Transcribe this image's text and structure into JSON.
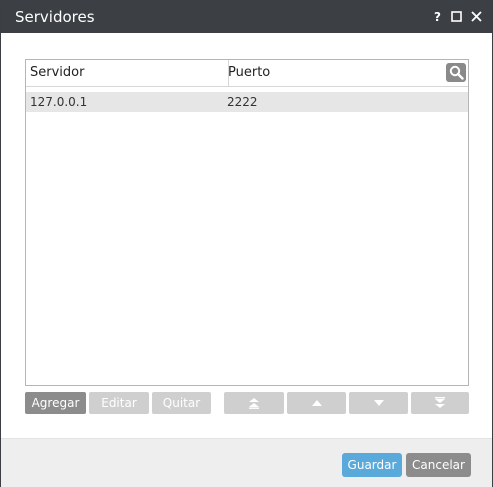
{
  "window": {
    "title": "Servidores",
    "help_glyph": "?",
    "colors": {
      "titlebar": "#3c4045",
      "accent": "#5aa9db",
      "button_active": "#8c8c8c",
      "button_disabled": "#cfcfcf"
    }
  },
  "table": {
    "columns": [
      "Servidor",
      "Puerto"
    ],
    "rows": [
      {
        "server": "127.0.0.1",
        "port": "2222"
      }
    ]
  },
  "toolbar": {
    "add_label": "Agregar",
    "edit_label": "Editar",
    "remove_label": "Quitar",
    "icons": [
      "move-to-top-icon",
      "move-up-icon",
      "move-down-icon",
      "move-to-bottom-icon"
    ]
  },
  "footer": {
    "save_label": "Guardar",
    "cancel_label": "Cancelar"
  }
}
